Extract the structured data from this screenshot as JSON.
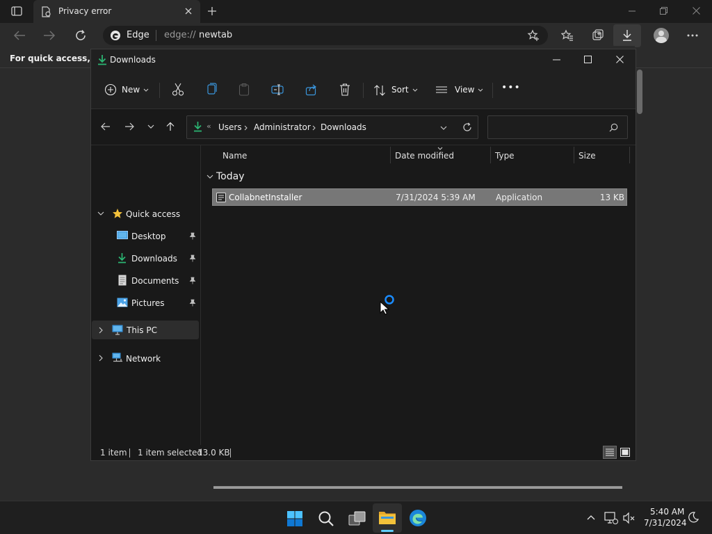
{
  "browser": {
    "tab_title": "Privacy error",
    "edge_label": "Edge",
    "url_prefix": "edge://",
    "url_host": "newtab",
    "favbar_text": "For quick access, plac"
  },
  "explorer": {
    "title": "Downloads",
    "commands": {
      "new": "New",
      "sort": "Sort",
      "view": "View",
      "more": "•••"
    },
    "breadcrumb": [
      "Users",
      "Administrator",
      "Downloads"
    ],
    "breadcrumb_overflow": "«",
    "nav": {
      "quick_access": "Quick access",
      "pinned": [
        "Desktop",
        "Downloads",
        "Documents",
        "Pictures"
      ],
      "this_pc": "This PC",
      "network": "Network"
    },
    "columns": [
      "Name",
      "Date modified",
      "Type",
      "Size"
    ],
    "group": "Today",
    "files": [
      {
        "name": "CollabnetInstaller",
        "date": "7/31/2024 5:39 AM",
        "type": "Application",
        "size": "13 KB"
      }
    ],
    "status": {
      "items": "1 item",
      "selected": "1 item selected",
      "size": "13.0 KB"
    }
  },
  "taskbar": {
    "time": "5:40 AM",
    "date": "7/31/2024"
  },
  "colors": {
    "accent": "#0078d4",
    "folder_yellow": "#f3c13a",
    "download_green": "#2bb673"
  }
}
